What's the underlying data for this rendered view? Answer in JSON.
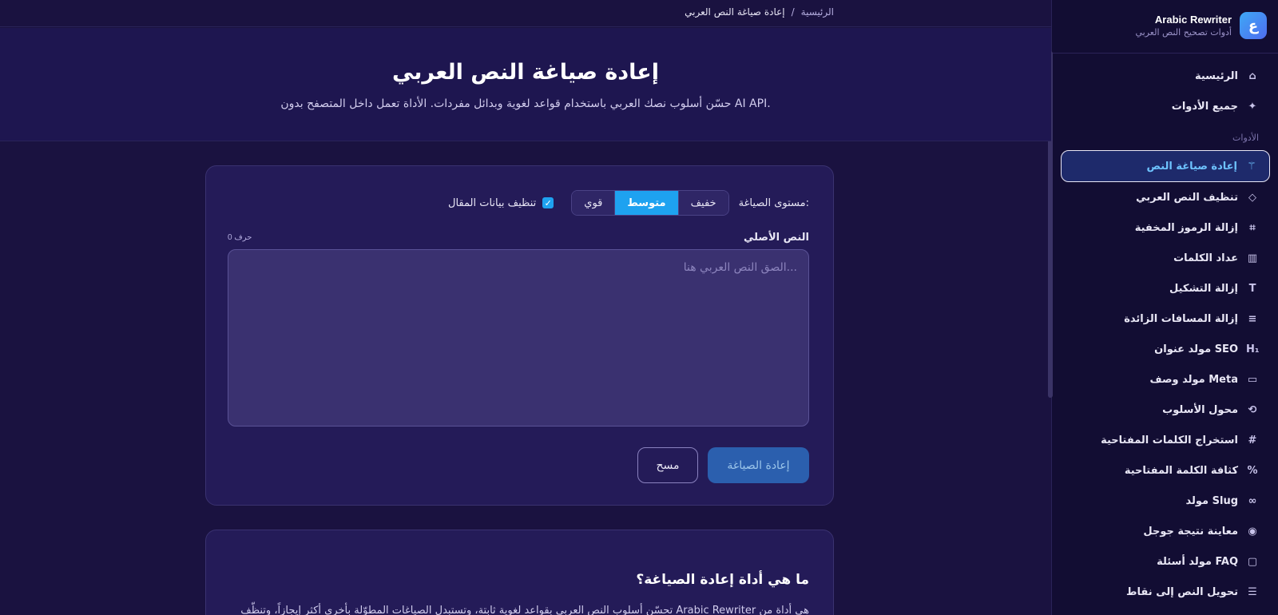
{
  "brand": {
    "name": "Arabic Rewriter",
    "subtitle": "أدوات تصحيح النص العربي",
    "logo_letter": "ع"
  },
  "nav_top": [
    {
      "label": "الرئيسية",
      "icon": "home-icon",
      "glyph": "⌂"
    },
    {
      "label": "جميع الأدوات",
      "icon": "sparkles-icon",
      "glyph": "✦"
    }
  ],
  "nav_section_label": "الأدوات",
  "nav_tools": [
    {
      "label": "إعادة صياغة النص",
      "icon": "wand-icon",
      "glyph": "⚚",
      "active": true
    },
    {
      "label": "تنظيف النص العربي",
      "icon": "eraser-icon",
      "glyph": "◇"
    },
    {
      "label": "إزالة الرموز المخفية",
      "icon": "scan-icon",
      "glyph": "⌗"
    },
    {
      "label": "عداد الكلمات",
      "icon": "chart-icon",
      "glyph": "▥"
    },
    {
      "label": "إزالة التشكيل",
      "icon": "type-icon",
      "glyph": "T"
    },
    {
      "label": "إزالة المسافات الزائدة",
      "icon": "lines-icon",
      "glyph": "≡"
    },
    {
      "label": "مولد عنوان SEO",
      "icon": "heading-icon",
      "glyph": "H₁"
    },
    {
      "label": "مولد وصف Meta",
      "icon": "file-icon",
      "glyph": "▭"
    },
    {
      "label": "محول الأسلوب",
      "icon": "repeat-icon",
      "glyph": "⟲"
    },
    {
      "label": "استخراج الكلمات المفتاحية",
      "icon": "hash-icon",
      "glyph": "#"
    },
    {
      "label": "كثافة الكلمة المفتاحية",
      "icon": "percent-icon",
      "glyph": "%"
    },
    {
      "label": "مولد Slug",
      "icon": "link-icon",
      "glyph": "∞"
    },
    {
      "label": "معاينة نتيجة جوجل",
      "icon": "eye-icon",
      "glyph": "◉"
    },
    {
      "label": "مولد أسئلة FAQ",
      "icon": "message-icon",
      "glyph": "▢"
    },
    {
      "label": "تحويل النص إلى نقاط",
      "icon": "list-icon",
      "glyph": "☰"
    }
  ],
  "breadcrumb": {
    "home": "الرئيسية",
    "separator": "/",
    "current": "إعادة صياغة النص العربي"
  },
  "hero": {
    "title": "إعادة صياغة النص العربي",
    "subtitle": "حسّن أسلوب نصك العربي باستخدام قواعد لغوية وبدائل مفردات. الأداة تعمل داخل المتصفح بدون AI API."
  },
  "tool": {
    "level_label": "مستوى الصياغة:",
    "levels": [
      "خفيف",
      "متوسط",
      "قوي"
    ],
    "selected_level": "متوسط",
    "clean_checkbox_label": "تنظيف بيانات المقال",
    "clean_checked": true,
    "input_label": "النص الأصلي",
    "char_count": "0 حرف",
    "placeholder": "الصق النص العربي هنا...",
    "submit_label": "إعادة الصياغة",
    "clear_label": "مسح"
  },
  "about": {
    "title": "ما هي أداة إعادة الصياغة؟",
    "body": "هي أداة من Arabic Rewriter تحسّن أسلوب النص العربي بقواعد لغوية ثابتة، وتستبدل الصياغات المطوّلة بأخرى أكثر إيجازاً، وتنظّف المسافات وعلامات الترقيم. تعمل داخل المتصفح فوراً وبدون أي اتصال بخادم خارجي."
  },
  "colors": {
    "accent": "#1ea2f0",
    "background": "#1a1240",
    "sidebar": "#120d33",
    "active_nav": "#1e2a6b"
  }
}
